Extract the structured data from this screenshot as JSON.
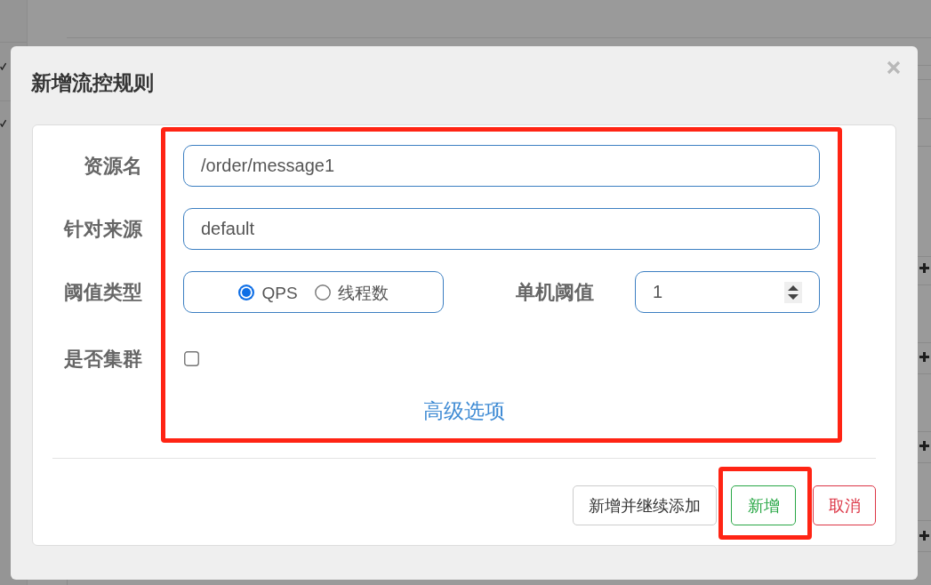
{
  "dialog": {
    "title": "新增流控规则",
    "fields": [
      {
        "kind": "text",
        "label": "资源名",
        "value": "/order/message1"
      },
      {
        "kind": "text",
        "label": "针对来源",
        "value": "default"
      },
      {
        "kind": "radio-number",
        "label": "阈值类型",
        "options": [
          {
            "label": "QPS",
            "selected": true
          },
          {
            "label": "线程数",
            "selected": false
          }
        ],
        "side_label": "单机阈值",
        "side_value": "1"
      },
      {
        "kind": "checkbox",
        "label": "是否集群",
        "checked": false
      }
    ],
    "advanced_link": "高级选项",
    "buttons": [
      {
        "kind": "default",
        "label": "新增并继续添加"
      },
      {
        "kind": "success",
        "label": "新增"
      },
      {
        "kind": "danger",
        "label": "取消"
      }
    ]
  }
}
